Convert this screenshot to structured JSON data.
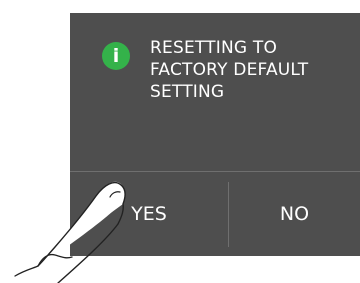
{
  "dialog": {
    "icon": "info-icon",
    "icon_glyph": "i",
    "icon_color": "#34b24a",
    "background_color": "#4e4e4e",
    "message_lines": [
      "RESETTING TO",
      "FACTORY DEFAULT",
      "SETTING"
    ]
  },
  "buttons": {
    "yes_label": "YES",
    "no_label": "NO"
  },
  "overlay": {
    "pointer": "pointing-hand-icon"
  }
}
